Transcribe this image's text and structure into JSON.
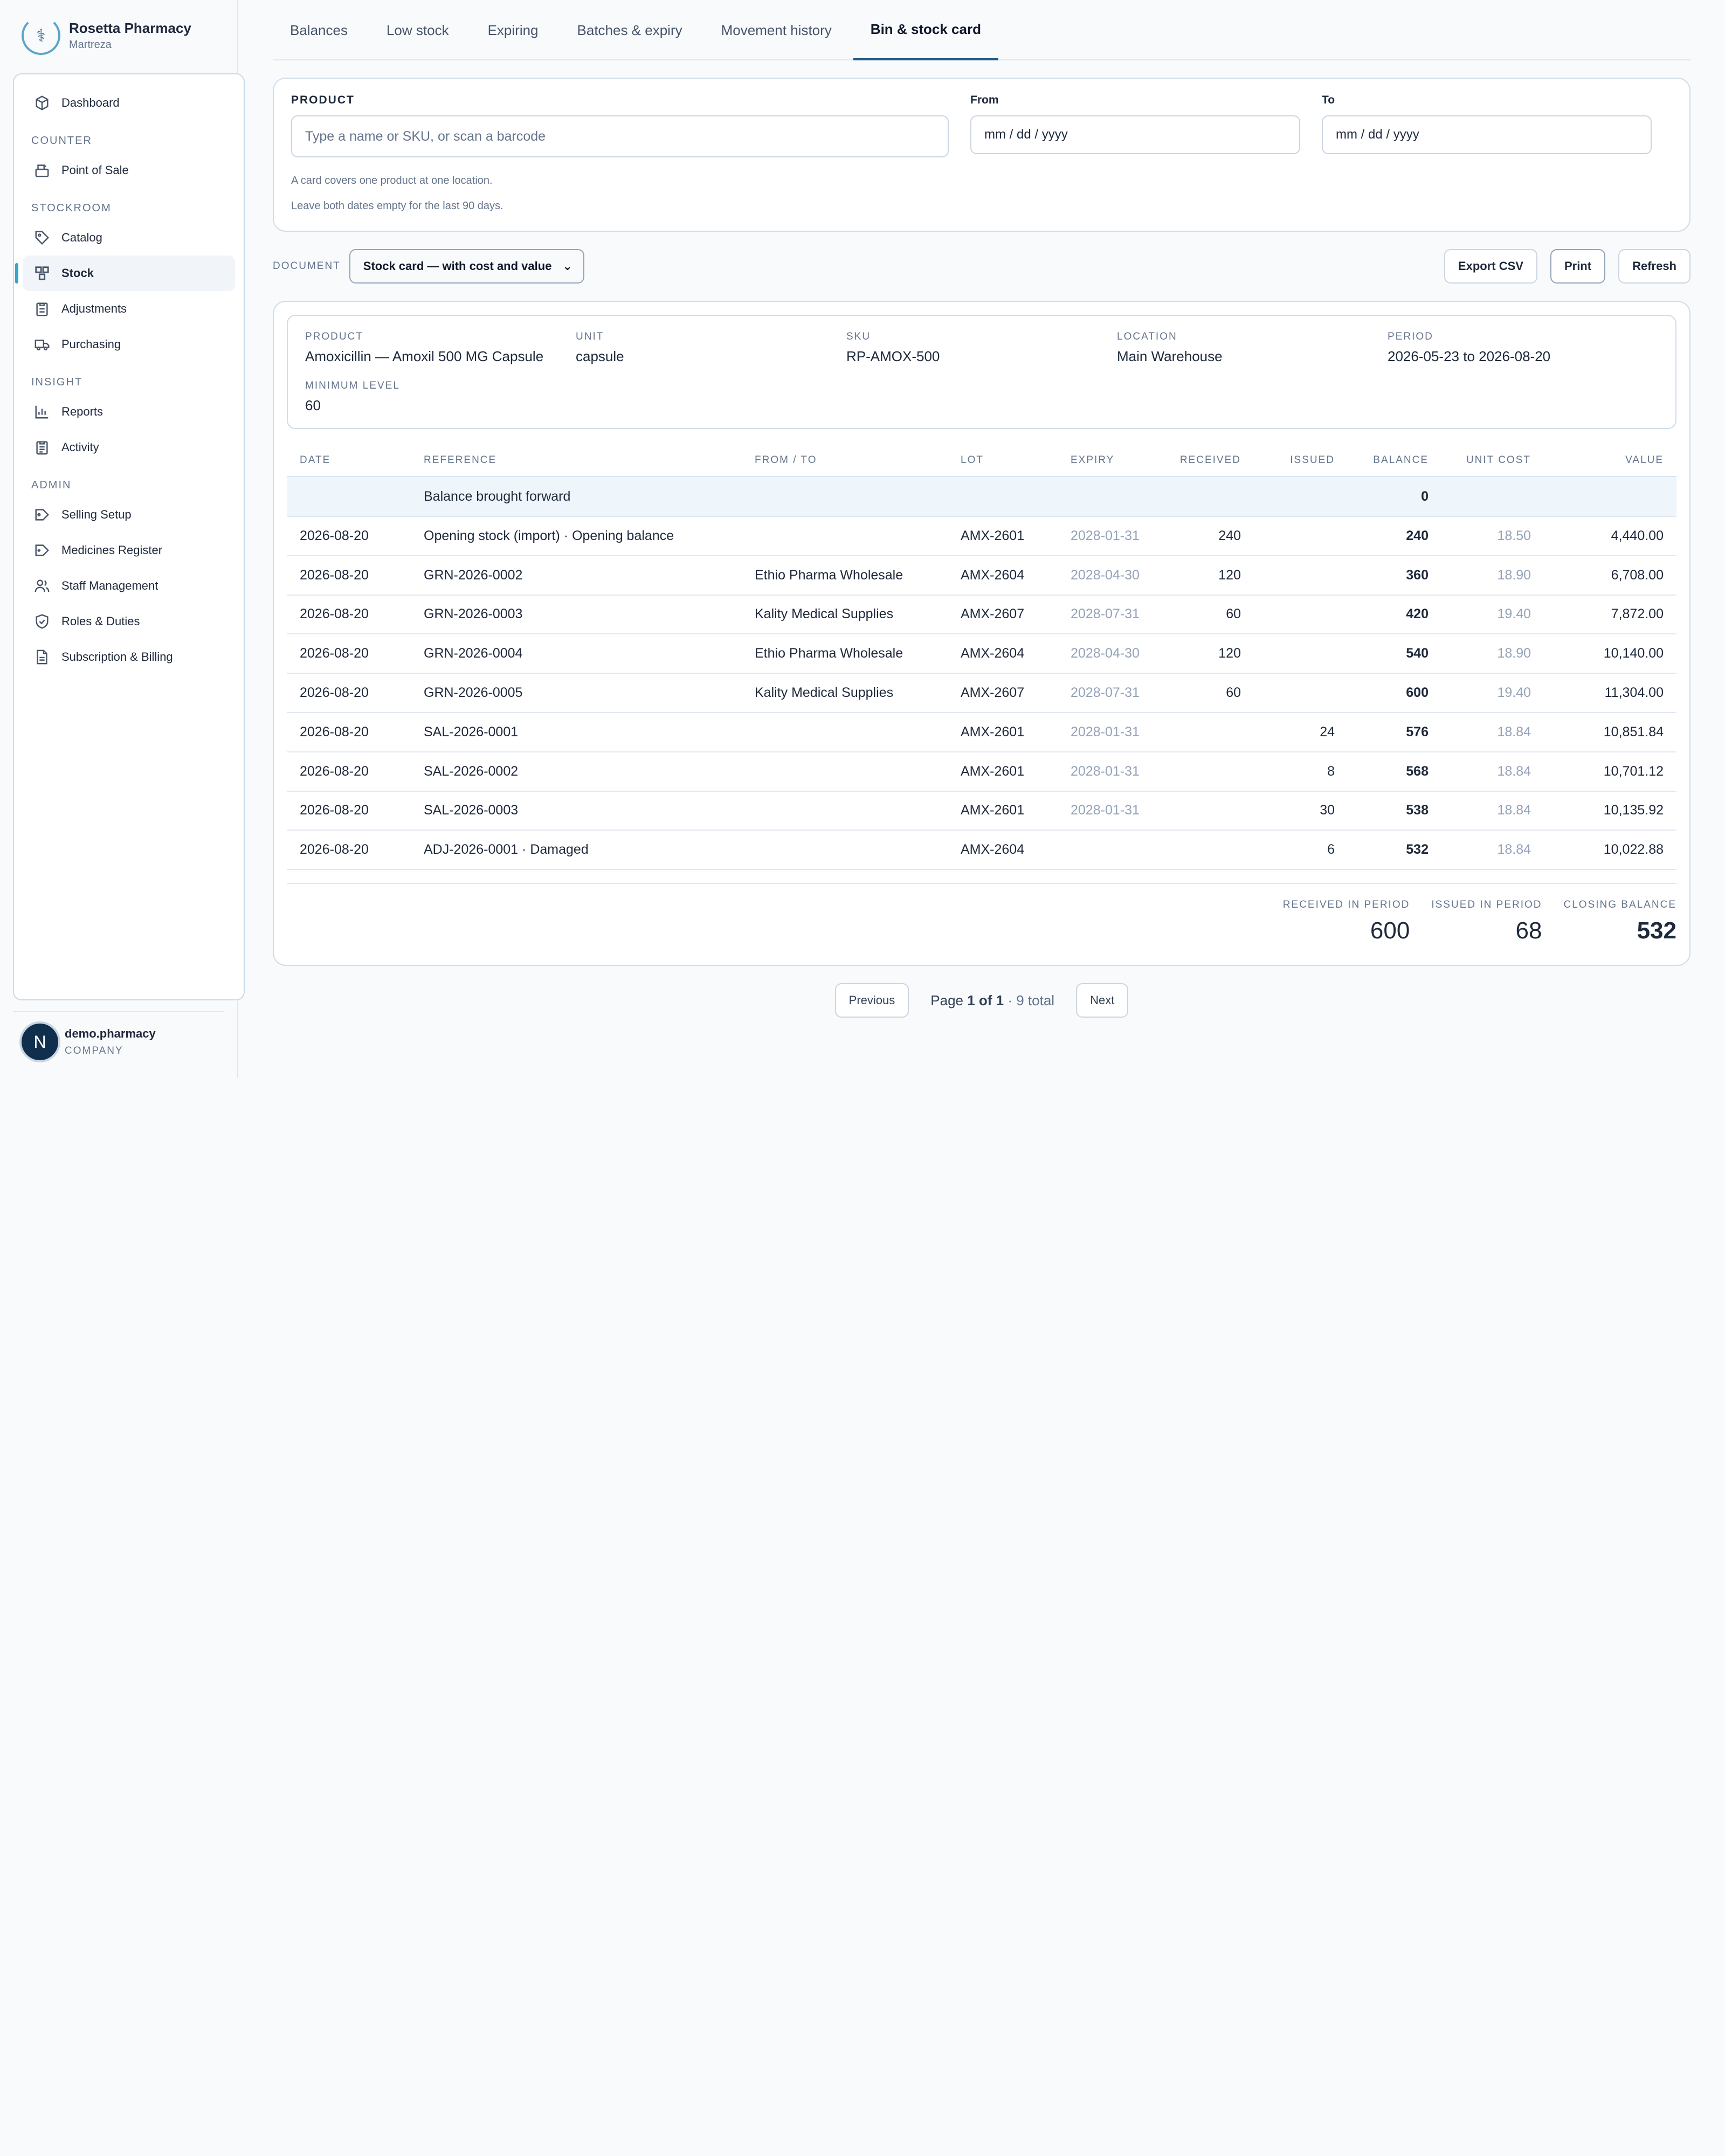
{
  "brand": {
    "name": "Rosetta Pharmacy",
    "sub": "Martreza"
  },
  "nav": {
    "dashboard": "Dashboard",
    "section_counter": "COUNTER",
    "pos": "Point of Sale",
    "section_stockroom": "STOCKROOM",
    "catalog": "Catalog",
    "stock": "Stock",
    "adjustments": "Adjustments",
    "purchasing": "Purchasing",
    "section_insight": "INSIGHT",
    "reports": "Reports",
    "activity": "Activity",
    "section_admin": "ADMIN",
    "selling_setup": "Selling Setup",
    "medicines_register": "Medicines Register",
    "staff_management": "Staff Management",
    "roles_duties": "Roles & Duties",
    "subscription_billing": "Subscription & Billing"
  },
  "user": {
    "initial": "N",
    "name": "demo.pharmacy",
    "role": "COMPANY"
  },
  "tabs": [
    "Balances",
    "Low stock",
    "Expiring",
    "Batches & expiry",
    "Movement history",
    "Bin & stock card"
  ],
  "filter": {
    "product_label": "PRODUCT",
    "product_placeholder": "Type a name or SKU, or scan a barcode",
    "from_label": "From",
    "from_value": "mm / dd / yyyy",
    "to_label": "To",
    "to_value": "mm / dd / yyyy",
    "hint1": "A card covers one product at one location.",
    "hint2": "Leave both dates empty for the last 90 days."
  },
  "document": {
    "label": "DOCUMENT",
    "selected": "Stock card — with cost and value",
    "export": "Export CSV",
    "print": "Print",
    "refresh": "Refresh"
  },
  "info": {
    "product_label": "PRODUCT",
    "product": "Amoxicillin — Amoxil 500 MG Capsule",
    "unit_label": "UNIT",
    "unit": "capsule",
    "sku_label": "SKU",
    "sku": "RP-AMOX-500",
    "location_label": "LOCATION",
    "location": "Main Warehouse",
    "period_label": "PERIOD",
    "period": "2026-05-23 to 2026-08-20",
    "min_label": "MINIMUM LEVEL",
    "min": "60"
  },
  "table": {
    "headers": {
      "date": "DATE",
      "reference": "REFERENCE",
      "fromto": "FROM / TO",
      "lot": "LOT",
      "expiry": "EXPIRY",
      "received": "RECEIVED",
      "issued": "ISSUED",
      "balance": "BALANCE",
      "unit_cost": "UNIT COST",
      "value": "VALUE"
    },
    "brought_forward": {
      "label": "Balance brought forward",
      "balance": "0"
    },
    "rows": [
      {
        "date": "2026-08-20",
        "reference": "Opening stock (import) · Opening balance",
        "fromto": "",
        "lot": "AMX-2601",
        "expiry": "2028-01-31",
        "received": "240",
        "issued": "",
        "balance": "240",
        "unit_cost": "18.50",
        "value": "4,440.00"
      },
      {
        "date": "2026-08-20",
        "reference": "GRN-2026-0002",
        "fromto": "Ethio Pharma Wholesale",
        "lot": "AMX-2604",
        "expiry": "2028-04-30",
        "received": "120",
        "issued": "",
        "balance": "360",
        "unit_cost": "18.90",
        "value": "6,708.00"
      },
      {
        "date": "2026-08-20",
        "reference": "GRN-2026-0003",
        "fromto": "Kality Medical Supplies",
        "lot": "AMX-2607",
        "expiry": "2028-07-31",
        "received": "60",
        "issued": "",
        "balance": "420",
        "unit_cost": "19.40",
        "value": "7,872.00"
      },
      {
        "date": "2026-08-20",
        "reference": "GRN-2026-0004",
        "fromto": "Ethio Pharma Wholesale",
        "lot": "AMX-2604",
        "expiry": "2028-04-30",
        "received": "120",
        "issued": "",
        "balance": "540",
        "unit_cost": "18.90",
        "value": "10,140.00"
      },
      {
        "date": "2026-08-20",
        "reference": "GRN-2026-0005",
        "fromto": "Kality Medical Supplies",
        "lot": "AMX-2607",
        "expiry": "2028-07-31",
        "received": "60",
        "issued": "",
        "balance": "600",
        "unit_cost": "19.40",
        "value": "11,304.00"
      },
      {
        "date": "2026-08-20",
        "reference": "SAL-2026-0001",
        "fromto": "",
        "lot": "AMX-2601",
        "expiry": "2028-01-31",
        "received": "",
        "issued": "24",
        "balance": "576",
        "unit_cost": "18.84",
        "value": "10,851.84"
      },
      {
        "date": "2026-08-20",
        "reference": "SAL-2026-0002",
        "fromto": "",
        "lot": "AMX-2601",
        "expiry": "2028-01-31",
        "received": "",
        "issued": "8",
        "balance": "568",
        "unit_cost": "18.84",
        "value": "10,701.12"
      },
      {
        "date": "2026-08-20",
        "reference": "SAL-2026-0003",
        "fromto": "",
        "lot": "AMX-2601",
        "expiry": "2028-01-31",
        "received": "",
        "issued": "30",
        "balance": "538",
        "unit_cost": "18.84",
        "value": "10,135.92"
      },
      {
        "date": "2026-08-20",
        "reference": "ADJ-2026-0001 · Damaged",
        "fromto": "",
        "lot": "AMX-2604",
        "expiry": "",
        "received": "",
        "issued": "6",
        "balance": "532",
        "unit_cost": "18.84",
        "value": "10,022.88"
      }
    ]
  },
  "totals": {
    "received_label": "RECEIVED IN PERIOD",
    "received": "600",
    "issued_label": "ISSUED IN PERIOD",
    "issued": "68",
    "closing_label": "CLOSING BALANCE",
    "closing": "532"
  },
  "pager": {
    "previous": "Previous",
    "page_prefix": "Page ",
    "page_current": "1 of 1",
    "page_total": " · 9 total",
    "next": "Next"
  }
}
